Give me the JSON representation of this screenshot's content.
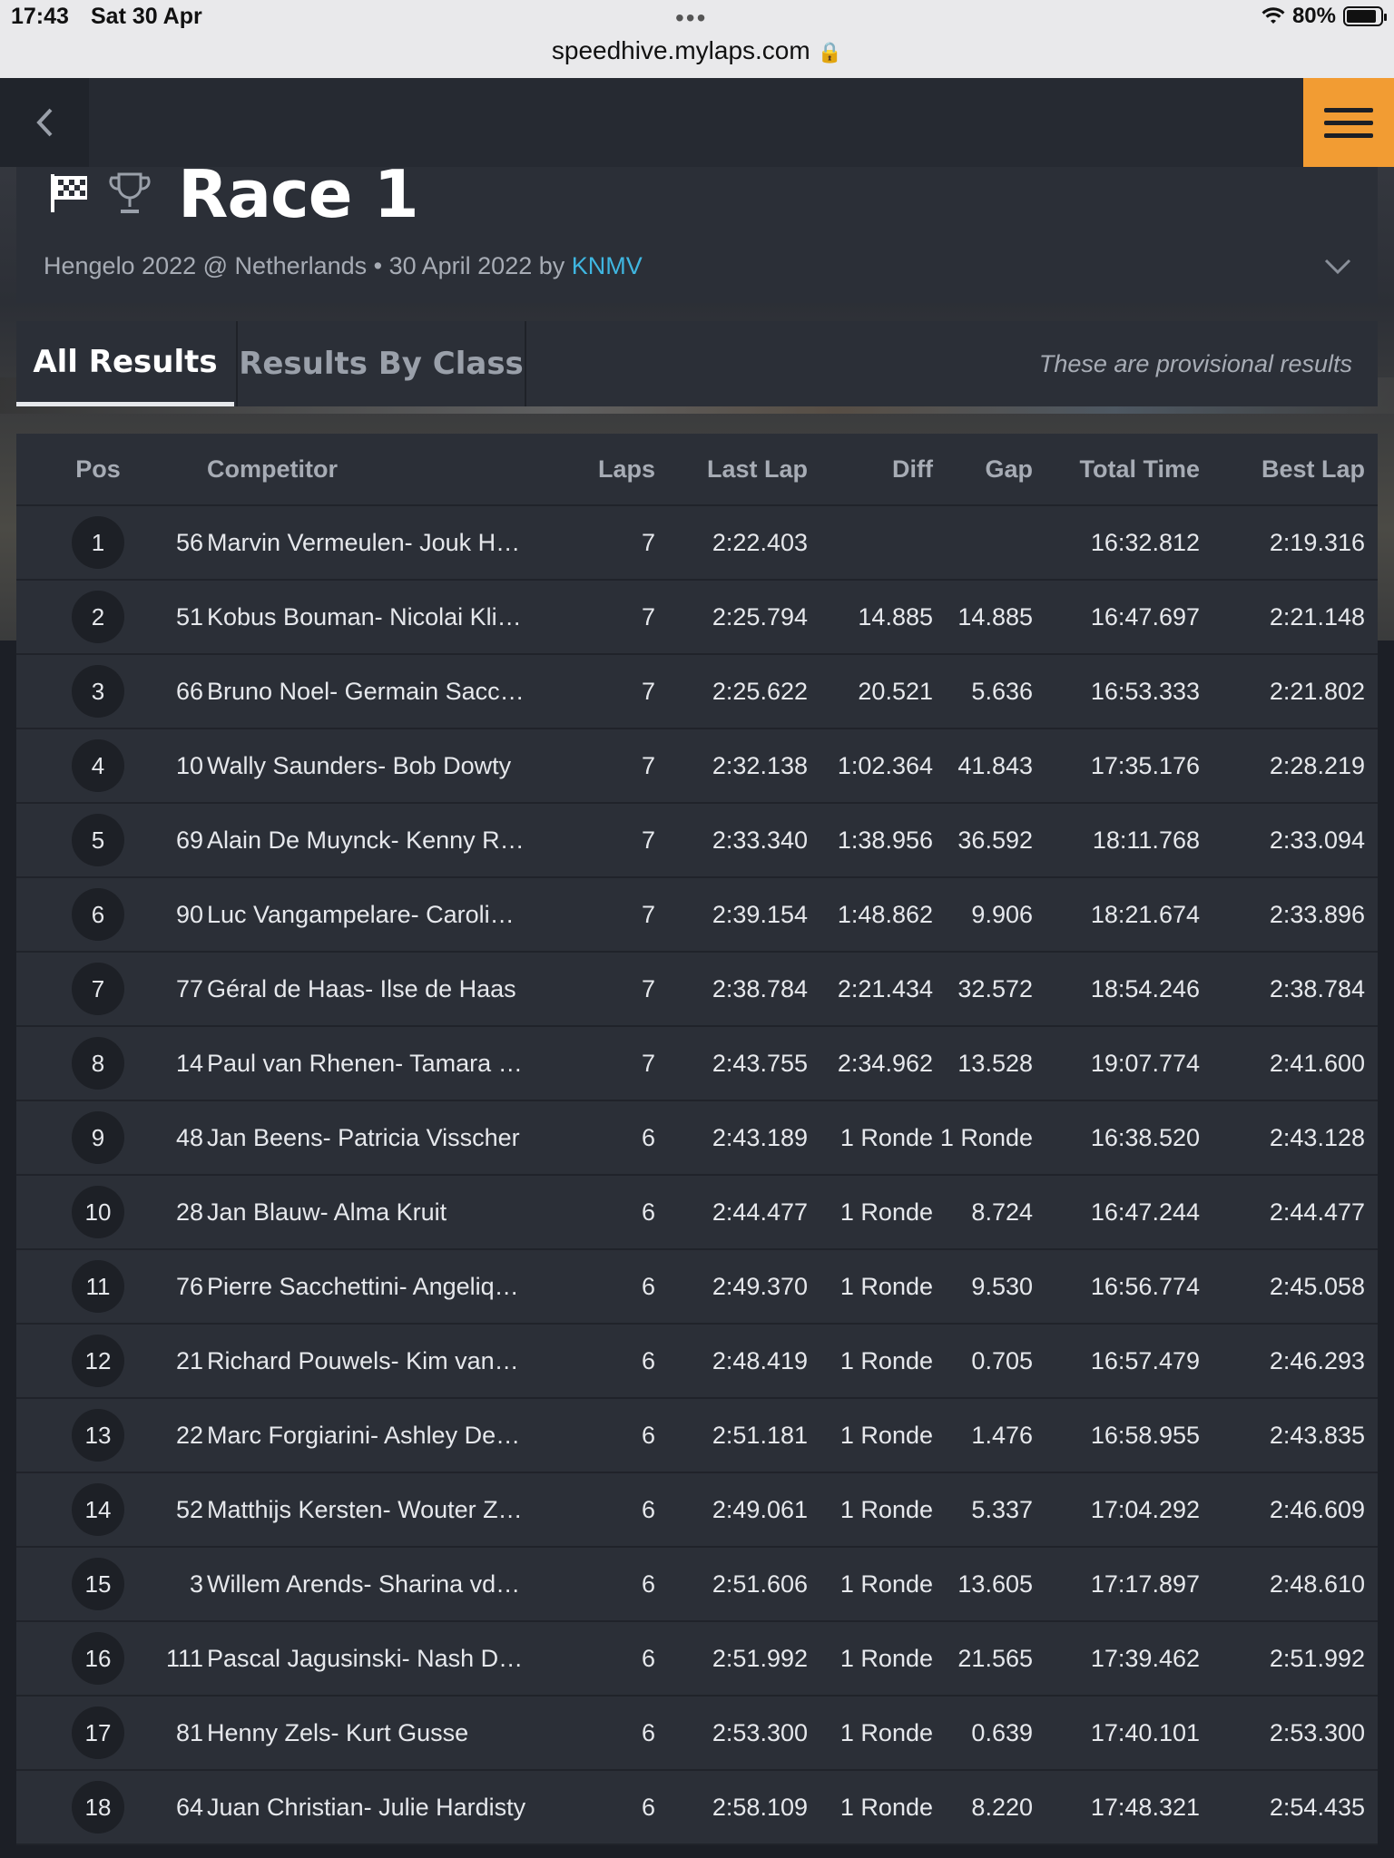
{
  "status_bar": {
    "time": "17:43",
    "date": "Sat 30 Apr",
    "dots": "•••",
    "battery": "80%",
    "url": "speedhive.mylaps.com"
  },
  "header": {
    "title": "Race 1",
    "event": "Hengelo 2022 @ Netherlands • 30 April 2022 by ",
    "organizer": "KNMV"
  },
  "tabs": [
    {
      "label": "All Results",
      "active": true
    },
    {
      "label": "Results By Class",
      "active": false
    }
  ],
  "provisional_note": "These are provisional results",
  "columns": {
    "pos": "Pos",
    "competitor": "Competitor",
    "laps": "Laps",
    "last_lap": "Last Lap",
    "diff": "Diff",
    "gap": "Gap",
    "total_time": "Total Time",
    "best_lap": "Best Lap"
  },
  "rows": [
    {
      "pos": "1",
      "num": "56",
      "name": "Marvin Vermeulen- Jouk H…",
      "laps": "7",
      "last": "2:22.403",
      "diff": "",
      "gap": "",
      "total": "16:32.812",
      "best": "2:19.316"
    },
    {
      "pos": "2",
      "num": "51",
      "name": "Kobus Bouman- Nicolai Kli…",
      "laps": "7",
      "last": "2:25.794",
      "diff": "14.885",
      "gap": "14.885",
      "total": "16:47.697",
      "best": "2:21.148"
    },
    {
      "pos": "3",
      "num": "66",
      "name": "Bruno Noel- Germain Sacc…",
      "laps": "7",
      "last": "2:25.622",
      "diff": "20.521",
      "gap": "5.636",
      "total": "16:53.333",
      "best": "2:21.802"
    },
    {
      "pos": "4",
      "num": "10",
      "name": "Wally Saunders- Bob Dowty",
      "laps": "7",
      "last": "2:32.138",
      "diff": "1:02.364",
      "gap": "41.843",
      "total": "17:35.176",
      "best": "2:28.219"
    },
    {
      "pos": "5",
      "num": "69",
      "name": "Alain De Muynck- Kenny R…",
      "laps": "7",
      "last": "2:33.340",
      "diff": "1:38.956",
      "gap": "36.592",
      "total": "18:11.768",
      "best": "2:33.094"
    },
    {
      "pos": "6",
      "num": "90",
      "name": "Luc Vangampelare- Caroli…",
      "laps": "7",
      "last": "2:39.154",
      "diff": "1:48.862",
      "gap": "9.906",
      "total": "18:21.674",
      "best": "2:33.896"
    },
    {
      "pos": "7",
      "num": "77",
      "name": "Géral de Haas- Ilse de Haas",
      "laps": "7",
      "last": "2:38.784",
      "diff": "2:21.434",
      "gap": "32.572",
      "total": "18:54.246",
      "best": "2:38.784"
    },
    {
      "pos": "8",
      "num": "14",
      "name": "Paul van Rhenen- Tamara …",
      "laps": "7",
      "last": "2:43.755",
      "diff": "2:34.962",
      "gap": "13.528",
      "total": "19:07.774",
      "best": "2:41.600"
    },
    {
      "pos": "9",
      "num": "48",
      "name": "Jan Beens- Patricia Visscher",
      "laps": "6",
      "last": "2:43.189",
      "diff": "1 Ronde",
      "gap": "1 Ronde",
      "total": "16:38.520",
      "best": "2:43.128"
    },
    {
      "pos": "10",
      "num": "28",
      "name": "Jan Blauw- Alma Kruit",
      "laps": "6",
      "last": "2:44.477",
      "diff": "1 Ronde",
      "gap": "8.724",
      "total": "16:47.244",
      "best": "2:44.477"
    },
    {
      "pos": "11",
      "num": "76",
      "name": "Pierre Sacchettini- Angeliq…",
      "laps": "6",
      "last": "2:49.370",
      "diff": "1 Ronde",
      "gap": "9.530",
      "total": "16:56.774",
      "best": "2:45.058"
    },
    {
      "pos": "12",
      "num": "21",
      "name": "Richard Pouwels- Kim van…",
      "laps": "6",
      "last": "2:48.419",
      "diff": "1 Ronde",
      "gap": "0.705",
      "total": "16:57.479",
      "best": "2:46.293"
    },
    {
      "pos": "13",
      "num": "22",
      "name": "Marc Forgiarini- Ashley De…",
      "laps": "6",
      "last": "2:51.181",
      "diff": "1 Ronde",
      "gap": "1.476",
      "total": "16:58.955",
      "best": "2:43.835"
    },
    {
      "pos": "14",
      "num": "52",
      "name": "Matthijs Kersten- Wouter Z…",
      "laps": "6",
      "last": "2:49.061",
      "diff": "1 Ronde",
      "gap": "5.337",
      "total": "17:04.292",
      "best": "2:46.609"
    },
    {
      "pos": "15",
      "num": "3",
      "name": "Willem Arends- Sharina vd…",
      "laps": "6",
      "last": "2:51.606",
      "diff": "1 Ronde",
      "gap": "13.605",
      "total": "17:17.897",
      "best": "2:48.610"
    },
    {
      "pos": "16",
      "num": "111",
      "name": "Pascal Jagusinski- Nash D…",
      "laps": "6",
      "last": "2:51.992",
      "diff": "1 Ronde",
      "gap": "21.565",
      "total": "17:39.462",
      "best": "2:51.992"
    },
    {
      "pos": "17",
      "num": "81",
      "name": "Henny Zels- Kurt Gusse",
      "laps": "6",
      "last": "2:53.300",
      "diff": "1 Ronde",
      "gap": "0.639",
      "total": "17:40.101",
      "best": "2:53.300"
    },
    {
      "pos": "18",
      "num": "64",
      "name": "Juan Christian- Julie Hardisty",
      "laps": "6",
      "last": "2:58.109",
      "diff": "1 Ronde",
      "gap": "8.220",
      "total": "17:48.321",
      "best": "2:54.435"
    }
  ],
  "colors": {
    "accent": "#f29c33",
    "link": "#3fb6e0",
    "panel": "#2b2f37"
  }
}
